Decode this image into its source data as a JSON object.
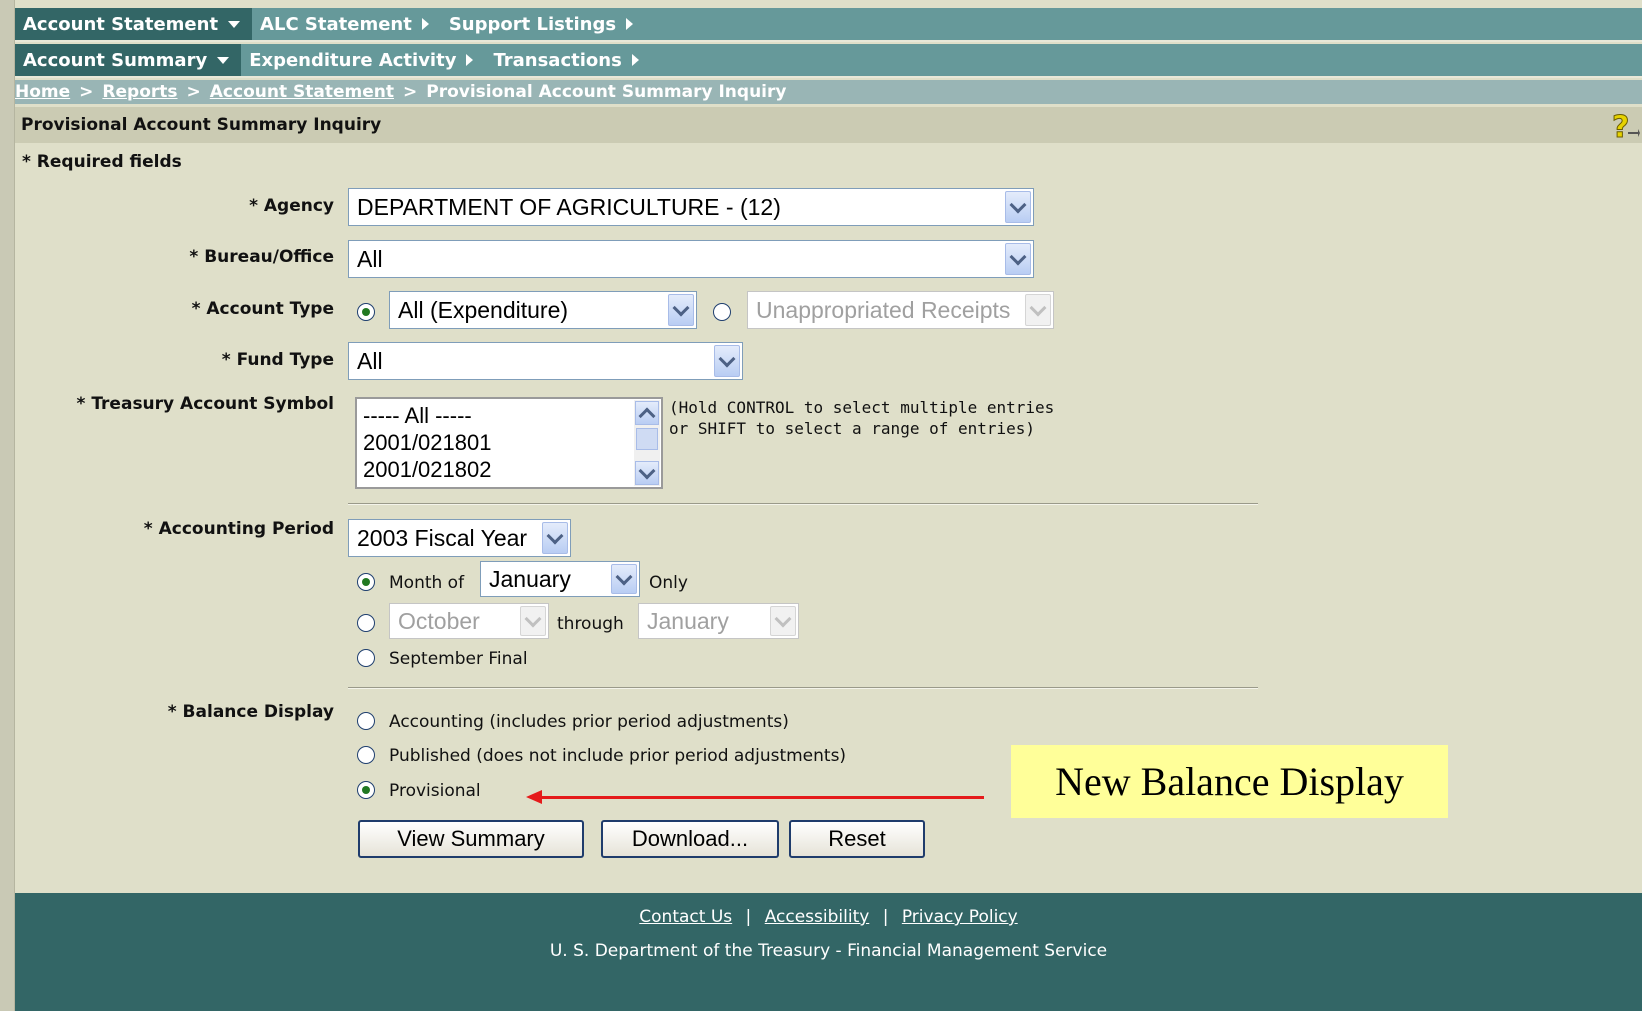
{
  "menu_primary": [
    {
      "label": "Account Statement",
      "caret": "down",
      "active": true
    },
    {
      "label": "ALC Statement",
      "caret": "right"
    },
    {
      "label": "Support Listings",
      "caret": "right"
    }
  ],
  "menu_secondary": [
    {
      "label": "Account Summary",
      "caret": "down",
      "active": true
    },
    {
      "label": "Expenditure Activity",
      "caret": "right"
    },
    {
      "label": "Transactions",
      "caret": "right"
    }
  ],
  "breadcrumb": {
    "links": [
      "Home",
      "Reports",
      "Account Statement"
    ],
    "current": "Provisional Account Summary Inquiry",
    "separator": ">"
  },
  "page_title": "Provisional Account Summary Inquiry",
  "help_icon": "help-question-icon",
  "required_note": "* Required fields",
  "form": {
    "agency": {
      "label": "* Agency",
      "value": "DEPARTMENT OF AGRICULTURE - (12)"
    },
    "bureau": {
      "label": "* Bureau/Office",
      "value": "All"
    },
    "account_type": {
      "label": "* Account Type",
      "option1_value": "All (Expenditure)",
      "option1_checked": true,
      "option2_value": "Unappropriated Receipts",
      "option2_checked": false
    },
    "fund_type": {
      "label": "* Fund Type",
      "value": "All"
    },
    "tas": {
      "label": "* Treasury Account Symbol",
      "options": [
        "----- All -----",
        "2001/021801",
        "2001/021802"
      ],
      "hint_line1": "(Hold CONTROL to select multiple entries",
      "hint_line2": "or SHIFT to select a range of entries)"
    },
    "accounting_period": {
      "label": "* Accounting Period",
      "year_value": "2003 Fiscal Year",
      "month_of_label": "Month of",
      "month_value": "January",
      "only_label": "Only",
      "range_from": "October",
      "through_label": "through",
      "range_to": "January",
      "september_final_label": "September Final",
      "selected": "month_of"
    },
    "balance_display": {
      "label": "* Balance Display",
      "options": [
        "Accounting (includes prior period adjustments)",
        "Published (does not include prior period adjustments)",
        "Provisional"
      ],
      "selected": "Provisional"
    }
  },
  "buttons": {
    "view_summary": "View Summary",
    "download": "Download...",
    "reset": "Reset"
  },
  "callout": {
    "text": "New Balance Display",
    "background": "#ffff99",
    "arrow_color": "#e51b1b"
  },
  "footer": {
    "links": [
      "Contact Us",
      "Accessibility",
      "Privacy Policy"
    ],
    "org": "U. S. Department of the Treasury - Financial Management Service"
  },
  "colors": {
    "menu_bg": "#66999a",
    "menu_active": "#336666",
    "breadcrumb_bg": "#99b5b5",
    "page_bg": "#dfdfc9",
    "footer_bg": "#336666"
  }
}
